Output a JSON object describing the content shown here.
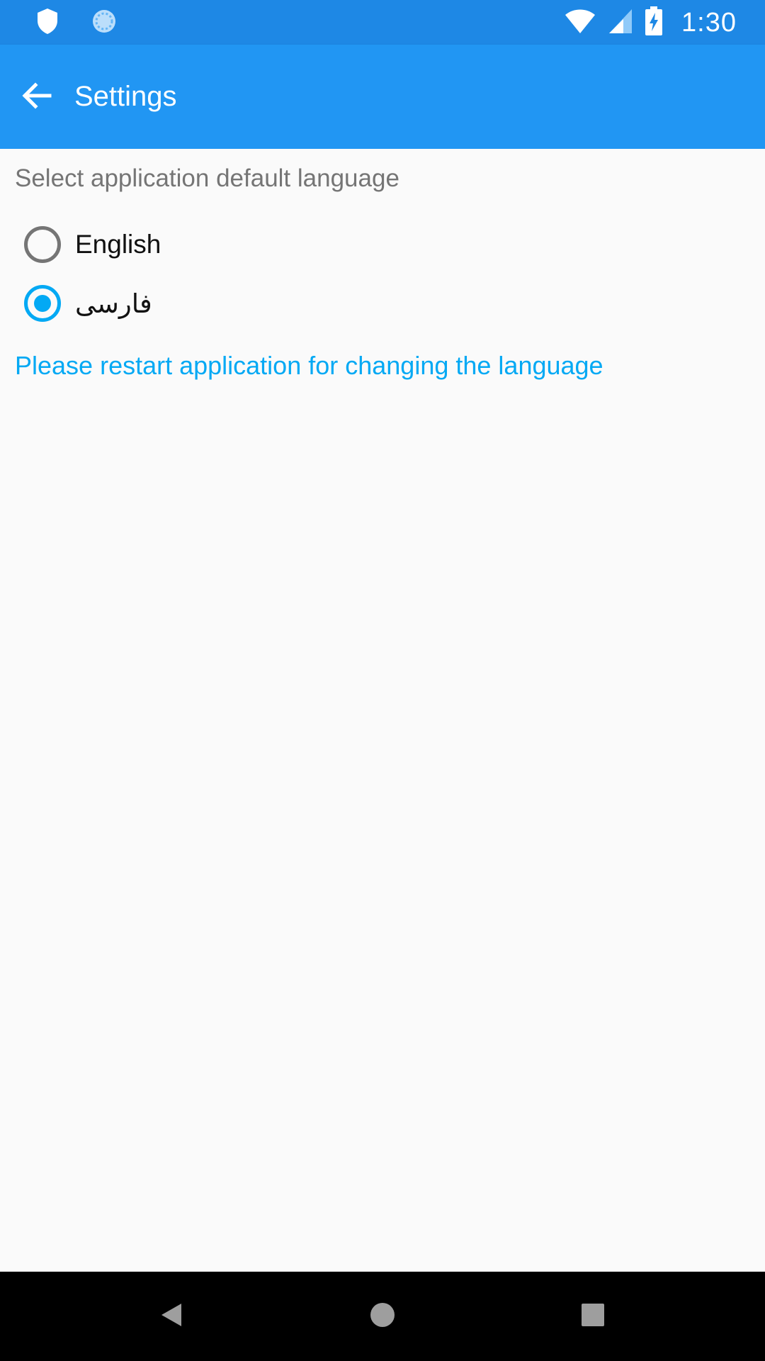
{
  "status_bar": {
    "time": "1:30",
    "icons": [
      "shield-icon",
      "sync-icon",
      "wifi-icon",
      "signal-icon",
      "battery-charging-icon"
    ],
    "background": "#1e88e5"
  },
  "app_bar": {
    "title": "Settings",
    "back_icon": "arrow-back-icon",
    "background": "#2196f3"
  },
  "settings": {
    "section_label": "Select application default language",
    "options": [
      {
        "label": "English",
        "selected": false
      },
      {
        "label": "فارسی",
        "selected": true
      }
    ],
    "notice": "Please restart application for changing the language",
    "accent_color": "#03a9f4"
  },
  "nav_bar": {
    "buttons": [
      "back-triangle-icon",
      "home-circle-icon",
      "recents-square-icon"
    ]
  }
}
